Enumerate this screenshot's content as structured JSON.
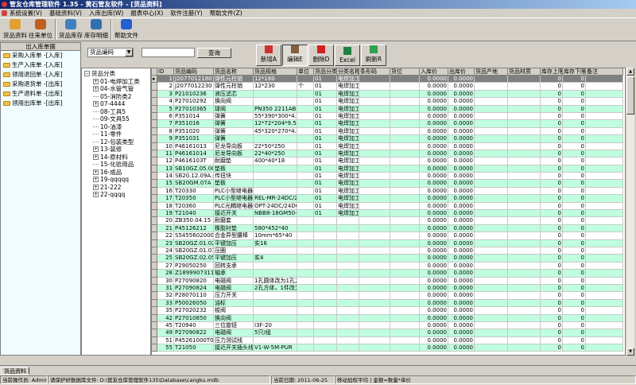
{
  "window": {
    "title": "管友仓库管理软件 1.35 - 黄石管友软件 - [货品资料]"
  },
  "menu": [
    "系统设置(V)",
    "基础资料(V)",
    "入库出库(W)",
    "报表中心(X)",
    "软件注册(Y)",
    "帮助文件(Z)"
  ],
  "toolbar": [
    {
      "label": "货品资料",
      "icon": "goods-icon",
      "color": "#e0a030"
    },
    {
      "label": "往来单位",
      "icon": "contacts-icon",
      "color": "#c06020"
    },
    {
      "label": "货品库存",
      "icon": "inventory-icon",
      "color": "#4080c0"
    },
    {
      "label": "库存明细",
      "icon": "stock-detail-icon",
      "color": "#3070b0"
    },
    {
      "label": "帮助文件",
      "icon": "help-icon",
      "color": "#2060d0"
    }
  ],
  "left_panel": {
    "title": "出入库单据",
    "items": [
      "采购入库单 -[入库]",
      "生产入库单 -[入库]",
      "领用退回单 -[入库]",
      "采购退货单 -[出库]",
      "生产退料单 -[出库]",
      "领用出库单 -[出库]"
    ]
  },
  "search": {
    "field": "货品编码",
    "value": "",
    "query_label": "查询"
  },
  "actions": [
    {
      "label": "新增A",
      "icon": "add-icon",
      "color": "#d03030"
    },
    {
      "label": "编辑E",
      "icon": "edit-icon",
      "color": "#806040"
    },
    {
      "label": "删除D",
      "icon": "delete-icon",
      "color": "#d02020"
    },
    {
      "label": "Excel",
      "icon": "excel-icon",
      "color": "#208040"
    },
    {
      "label": "刷新R",
      "icon": "refresh-icon",
      "color": "#30a050"
    }
  ],
  "tree": {
    "root": "货品分类",
    "nodes": [
      {
        "label": "01-电焊加工类",
        "exp": true
      },
      {
        "label": "04-水管气管",
        "exp": true
      },
      {
        "label": "05-消防类2",
        "exp": false
      },
      {
        "label": "07-4444",
        "exp": true
      },
      {
        "label": "08-工具5",
        "exp": false
      },
      {
        "label": "09-文具55",
        "exp": false
      },
      {
        "label": "10-油漆",
        "exp": false
      },
      {
        "label": "11-零件",
        "exp": false
      },
      {
        "label": "12-包装类型",
        "exp": false
      },
      {
        "label": "13-装修",
        "exp": true
      },
      {
        "label": "14-原材料",
        "exp": true
      },
      {
        "label": "15-化验用品",
        "exp": false
      },
      {
        "label": "16-成品",
        "exp": true
      },
      {
        "label": "19-qqqqq",
        "exp": true
      },
      {
        "label": "21-222",
        "exp": true
      },
      {
        "label": "22-qqqq",
        "exp": true
      }
    ]
  },
  "grid": {
    "columns": [
      "ID",
      "货品编码",
      "货品名称",
      "货品规格",
      "单位",
      "货品分类",
      "分类名称",
      "条形码",
      "货位",
      "入库价",
      "出库价",
      "货品产地",
      "货品材质",
      "库存上限",
      "库存下限",
      "备注"
    ],
    "rows": [
      [
        "1",
        "J2077012180",
        "弹性元柱销",
        "12*180",
        "",
        "01",
        "电焊加工"
      ],
      [
        "2",
        "J2077012230",
        "弹性元柱销",
        "12*230",
        "个",
        "01",
        "电焊加工"
      ],
      [
        "3",
        "P21010236",
        "液压滤芯",
        "",
        "",
        "01",
        "电焊加工"
      ],
      [
        "4",
        "P27010292",
        "换向阀",
        "",
        "",
        "01",
        "电焊加工"
      ],
      [
        "5",
        "P27010365",
        "球阀",
        "PN350  2211AB",
        "",
        "01",
        "电焊加工"
      ],
      [
        "6",
        "P351014",
        "弹簧",
        "55*390*300*4.5",
        "",
        "01",
        "电焊加工"
      ],
      [
        "7",
        "P351016",
        "弹簧",
        "12*72*204*9.5",
        "",
        "01",
        "电焊加工"
      ],
      [
        "8",
        "P351020",
        "弹簧",
        "45*320*270*4.5",
        "",
        "01",
        "电焊加工"
      ],
      [
        "9",
        "P351031",
        "弹簧",
        "",
        "",
        "01",
        "电焊加工"
      ],
      [
        "10",
        "P46161013",
        "尼龙导向板",
        "22*50*250",
        "",
        "01",
        "电焊加工"
      ],
      [
        "11",
        "P46161014",
        "尼龙导向板",
        "22*40*250",
        "",
        "01",
        "电焊加工"
      ],
      [
        "12",
        "P4616103T",
        "耐磨垫",
        "400*40*18",
        "",
        "01",
        "电焊加工"
      ],
      [
        "13",
        "SB10GZ.05.00",
        "垫板",
        "",
        "",
        "01",
        "电焊加工"
      ],
      [
        "14",
        "SB20.12.09A.02",
        "传扭块",
        "",
        "",
        "01",
        "电焊加工"
      ],
      [
        "15",
        "SB20GM.07A",
        "垫板",
        "",
        "",
        "01",
        "电焊加工"
      ],
      [
        "16",
        "T20330",
        "PLC小型继电器",
        "",
        "",
        "01",
        "电焊加工"
      ],
      [
        "17",
        "T20350",
        "PLC小型继电器芯",
        "REL-MR-24DC/21",
        "",
        "01",
        "电焊加工"
      ],
      [
        "18",
        "T20360",
        "PLC光耦继电器芯",
        "OPT-24DC/24DC",
        "",
        "01",
        "电焊加工"
      ],
      [
        "19",
        "T21040",
        "接近开关",
        "NBB8-18GM50-E2-V",
        "",
        "01",
        "电焊加工"
      ],
      [
        "20",
        "ZB350.04.15",
        "耐磨套",
        "",
        "",
        "",
        ""
      ],
      [
        "21",
        "P45126212",
        "橡胶衬垫",
        "580*452*40",
        "",
        "",
        ""
      ],
      [
        "22",
        "S5455602000004",
        "合金异型腰棒",
        "10mm*65*40",
        "",
        "",
        ""
      ],
      [
        "23",
        "SB20GZ.01.02A",
        "平键加压",
        "实16",
        "",
        "",
        ""
      ],
      [
        "24",
        "SB20GZ.01.07.03",
        "压圈",
        "",
        "",
        "",
        ""
      ],
      [
        "25",
        "SB20GZ.02.05",
        "平键加压",
        "实4",
        "",
        "",
        ""
      ],
      [
        "27",
        "P29050250",
        "回转支承",
        "",
        "",
        "",
        ""
      ],
      [
        "28",
        "Z18999073110",
        "轴承",
        "",
        "",
        "",
        ""
      ],
      [
        "30",
        "P27090820",
        "电磁阀",
        "1孔圆体改为1孔方",
        "",
        "",
        ""
      ],
      [
        "31",
        "P27090824",
        "电磁阀",
        "2孔方体，1件改为",
        "",
        "",
        ""
      ],
      [
        "32",
        "P28070110",
        "压力开关",
        "",
        "",
        "",
        ""
      ],
      [
        "33",
        "P50026050",
        "油标",
        "",
        "",
        "",
        ""
      ],
      [
        "35",
        "P27020232",
        "梭阀",
        "",
        "",
        "",
        ""
      ],
      [
        "42",
        "P27010850",
        "换向阀",
        "",
        "",
        "",
        ""
      ],
      [
        "45",
        "T20940",
        "三位旋钮",
        "I3F-20",
        "",
        "",
        ""
      ],
      [
        "49",
        "P27090822",
        "电磁阀",
        "5只/组",
        "",
        "",
        ""
      ],
      [
        "51",
        "P45261000T0",
        "压力测试线",
        "",
        "",
        "",
        ""
      ],
      [
        "55",
        "T21050",
        "接近开关插头线",
        "V1-W-5M-PUR",
        "",
        "",
        ""
      ]
    ],
    "in_price": "0.0000",
    "out_price": "0.0000",
    "stock_max": "0",
    "stock_min": "0",
    "selected_row": 1,
    "row_colors": {
      "odd": "#bfffdf",
      "even": "#ffffff",
      "selected": "#808080"
    }
  },
  "tab": "货品资料",
  "status": {
    "operator": "当前操作员: Admin",
    "db": "请保护好数据库文件: D:\\管友仓库管理软件135\\Database\\cangku.mdb",
    "date": "当前日期: 2011-06-25",
    "method": "移动加权平均 | 金额=数量*单价"
  }
}
